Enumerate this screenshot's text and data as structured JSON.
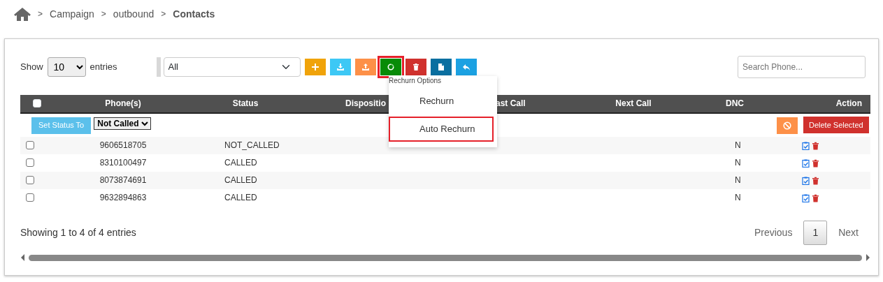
{
  "breadcrumb": [
    {
      "separator": ">",
      "label": "Campaign",
      "current": false
    },
    {
      "separator": ">",
      "label": "outbound",
      "current": false
    },
    {
      "separator": ">",
      "label": "Contacts",
      "current": true
    }
  ],
  "length_control": {
    "before": "Show",
    "value": "10",
    "after": "entries"
  },
  "filter": {
    "value": "All"
  },
  "toolbar": [
    {
      "kind": "add",
      "color": "#f0a30a",
      "highlighted": false
    },
    {
      "kind": "download",
      "color": "#3dc8f5",
      "highlighted": false
    },
    {
      "kind": "upload",
      "color": "#fd9048",
      "highlighted": false
    },
    {
      "kind": "refresh",
      "color": "#078b07",
      "highlighted": true
    },
    {
      "kind": "delete",
      "color": "#d0312d",
      "highlighted": false
    },
    {
      "kind": "copy",
      "color": "#0a6fa0",
      "highlighted": false
    },
    {
      "kind": "back",
      "color": "#1ba1e2",
      "highlighted": false
    }
  ],
  "tooltip": "Rechurn Options",
  "menu": [
    {
      "label": "Rechurn",
      "highlighted": false
    },
    {
      "label": "Auto Rechurn",
      "highlighted": true
    }
  ],
  "search": {
    "placeholder": "Search Phone..."
  },
  "table": {
    "columns": [
      "Phone(s)",
      "Status",
      "Dispositio",
      "ast Call",
      "Next Call",
      "DNC",
      "Action"
    ],
    "all_checked": false,
    "set_status_button": "Set Status To",
    "status_select": "Not Called",
    "delete_selected": "Delete Selected",
    "rows": [
      {
        "checked": false,
        "phone": "9606518705",
        "status": "NOT_CALLED",
        "dnc": "N"
      },
      {
        "checked": false,
        "phone": "8310100497",
        "status": "CALLED",
        "dnc": "N"
      },
      {
        "checked": false,
        "phone": "8073874691",
        "status": "CALLED",
        "dnc": "N"
      },
      {
        "checked": false,
        "phone": "9632894863",
        "status": "CALLED",
        "dnc": "N"
      }
    ]
  },
  "info": "Showing 1 to 4 of 4 entries",
  "pagination": [
    {
      "label": "Previous",
      "selected": false
    },
    {
      "label": "1",
      "selected": true
    },
    {
      "label": "Next",
      "selected": false
    }
  ]
}
